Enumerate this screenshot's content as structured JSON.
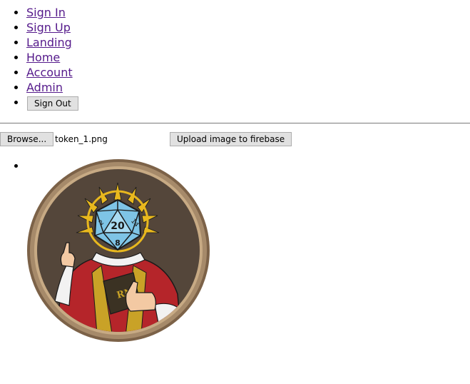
{
  "nav": {
    "links": [
      {
        "label": "Sign In"
      },
      {
        "label": "Sign Up"
      },
      {
        "label": "Landing"
      },
      {
        "label": "Home"
      },
      {
        "label": "Account"
      },
      {
        "label": "Admin"
      }
    ],
    "sign_out_label": "Sign Out"
  },
  "upload": {
    "browse_label": "Browse...",
    "file_name": "token_1.png",
    "upload_label": "Upload image to firebase"
  },
  "token": {
    "die_top_number": "20",
    "die_bottom_number": "8",
    "die_left_number": "2",
    "die_right_number": "14",
    "ring_color": "#a68a6a",
    "background_color": "#54463a"
  }
}
